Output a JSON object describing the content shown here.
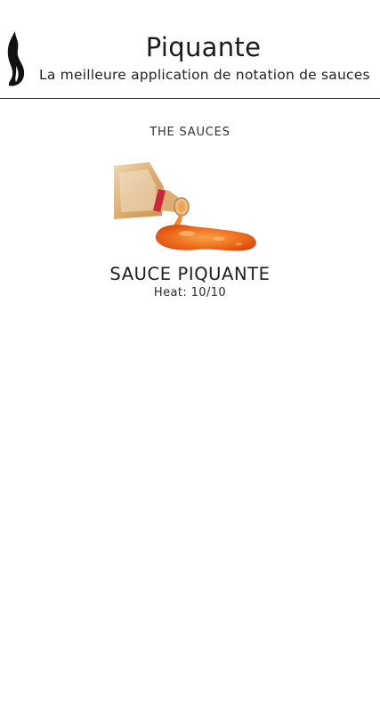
{
  "header": {
    "logo_icon": "flame-icon",
    "title": "Piquante",
    "subtitle": "La meilleure application de notation de sauces"
  },
  "main": {
    "section_title": "THE SAUCES",
    "sauces": [
      {
        "image_icon": "hot-sauce-bottle-image",
        "name": "SAUCE PIQUANTE",
        "heat": "Heat: 10/10"
      }
    ]
  },
  "colors": {
    "sauce": "#e8611a",
    "bottle_glass": "#d9b07a",
    "bottle_band": "#c8283a",
    "divider": "#2b2b2b"
  }
}
